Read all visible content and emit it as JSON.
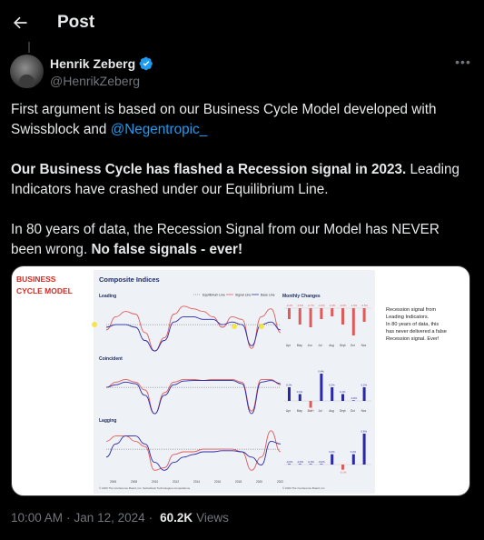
{
  "header": {
    "title": "Post",
    "back_icon": "arrow-left-icon"
  },
  "author": {
    "display_name": "Henrik Zeberg",
    "handle": "@HenrikZeberg",
    "verified": true,
    "verified_color": "#1d9bf0"
  },
  "tweet": {
    "p1_text": "First argument is based on our Business Cycle Model developed with Swissblock and ",
    "p1_mention": "@Negentropic_",
    "p2_bold": "Our Business Cycle has flashed a Recession signal in 2023.",
    "p2_text": " Leading Indicators have crashed under our Equilibrium Line.",
    "p3_text": "In 80 years of data, the Recession Signal from our Model has NEVER been wrong. ",
    "p3_bold": "No false signals - ever!"
  },
  "media": {
    "badge_line1": "BUSINESS",
    "badge_line2": "CYCLE MODEL",
    "chart_title": "Composite Indices",
    "panel_leading": "Leading",
    "panel_coincident": "Coincident",
    "panel_lagging": "Lagging",
    "legend_equilibrium": "Equilibrium Line",
    "legend_signal": "Signal Line",
    "legend_base": "Base Line",
    "monthly_title": "Monthly Changes",
    "months": [
      "Apr",
      "May",
      "Jun",
      "Jul",
      "Aug",
      "Sept",
      "Oct",
      "Nov"
    ],
    "years": [
      "2006",
      "2008",
      "2010",
      "2012",
      "2014",
      "2016",
      "2018",
      "2020",
      "2022"
    ],
    "leading_labels": [
      "-0.4%",
      "-0.6%",
      "-0.7%",
      "-0.4%",
      "-0.3%",
      "-0.6%",
      "-1.0%",
      "-0.5%"
    ],
    "leading_values": [
      -0.4,
      -0.6,
      -0.7,
      -0.4,
      -0.3,
      -0.6,
      -1.0,
      -0.5
    ],
    "coincident_labels": [
      "0.2%",
      "0.1%",
      "-0.1%",
      "0.4%",
      "0.2%",
      "0.1%",
      "-0.0%",
      "0.2%"
    ],
    "coincident_values": [
      0.2,
      0.1,
      -0.1,
      0.4,
      0.2,
      0.1,
      0.0,
      0.2
    ],
    "lagging_labels": [
      "-0.0%",
      "-0.0%",
      "-0.0%",
      "-0.0%",
      "0.2%",
      "-0.1%",
      "0.2%",
      "0.6%"
    ],
    "lagging_values": [
      0.0,
      0.0,
      0.0,
      0.0,
      0.2,
      -0.1,
      0.2,
      0.6
    ],
    "source_left": "© 2023 The Conference Board, Inc. Swissblock Technologies computations.",
    "source_right": "© 2023 The Conference Board, Inc.",
    "annotation": [
      "Recession signal from",
      "Leading Indicators.",
      "In 80 years of data, this",
      "has never delivered a false",
      "Recession signal. Ever!"
    ],
    "colors": {
      "red": "#e05a5a",
      "blue": "#2929a8",
      "badge_red": "#d9251c"
    }
  },
  "meta": {
    "time": "10:00 AM",
    "date": "Jan 12, 2024",
    "views_count": "60.2K",
    "views_label": "Views"
  }
}
